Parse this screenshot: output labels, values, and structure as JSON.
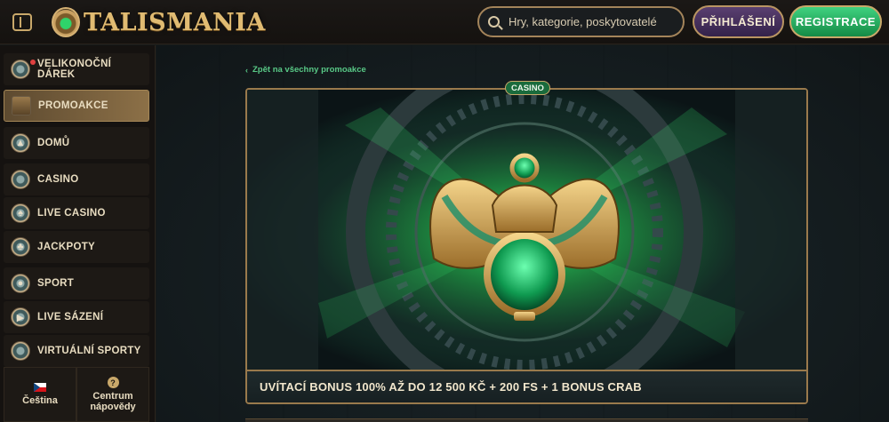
{
  "header": {
    "logo_text": "TALISMANIA",
    "search_placeholder": "Hry, kategorie, poskytovatelé",
    "login_label": "PŘIHLÁŠENÍ",
    "register_label": "REGISTRACE"
  },
  "sidebar": {
    "items": [
      {
        "label": "VELIKONOČNÍ DÁREK",
        "icon": "easter-gift-icon",
        "active": false,
        "has_dot": true
      },
      {
        "label": "PROMOAKCE",
        "icon": "treasure-chest-icon",
        "active": true
      },
      {
        "label": "DOMŮ",
        "icon": "home-pyramid-icon",
        "active": false
      },
      {
        "label": "CASINO",
        "icon": "casino-chip-icon",
        "active": false
      },
      {
        "label": "LIVE CASINO",
        "icon": "spade-icon",
        "active": false
      },
      {
        "label": "JACKPOTY",
        "icon": "clover-icon",
        "active": false
      },
      {
        "label": "SPORT",
        "icon": "soccer-ball-icon",
        "active": false
      },
      {
        "label": "LIVE SÁZENÍ",
        "icon": "play-icon",
        "active": false
      },
      {
        "label": "VIRTUÁLNÍ SPORTY",
        "icon": "gamepad-icon",
        "active": false
      }
    ],
    "footer": {
      "language_label": "Čeština",
      "help_label_line1": "Centrum",
      "help_label_line2": "nápovědy"
    }
  },
  "main": {
    "back_link": "Zpět na všechny promoakce",
    "badge": "CASINO",
    "promo_title": "UVÍTACÍ BONUS 100% AŽ DO 12 500 KČ + 200 FS + 1 BONUS CRAB"
  },
  "colors": {
    "accent_gold": "#c9a86a",
    "register_green": "#2fb866",
    "login_purple": "#4a3360",
    "link_green": "#58c886"
  }
}
